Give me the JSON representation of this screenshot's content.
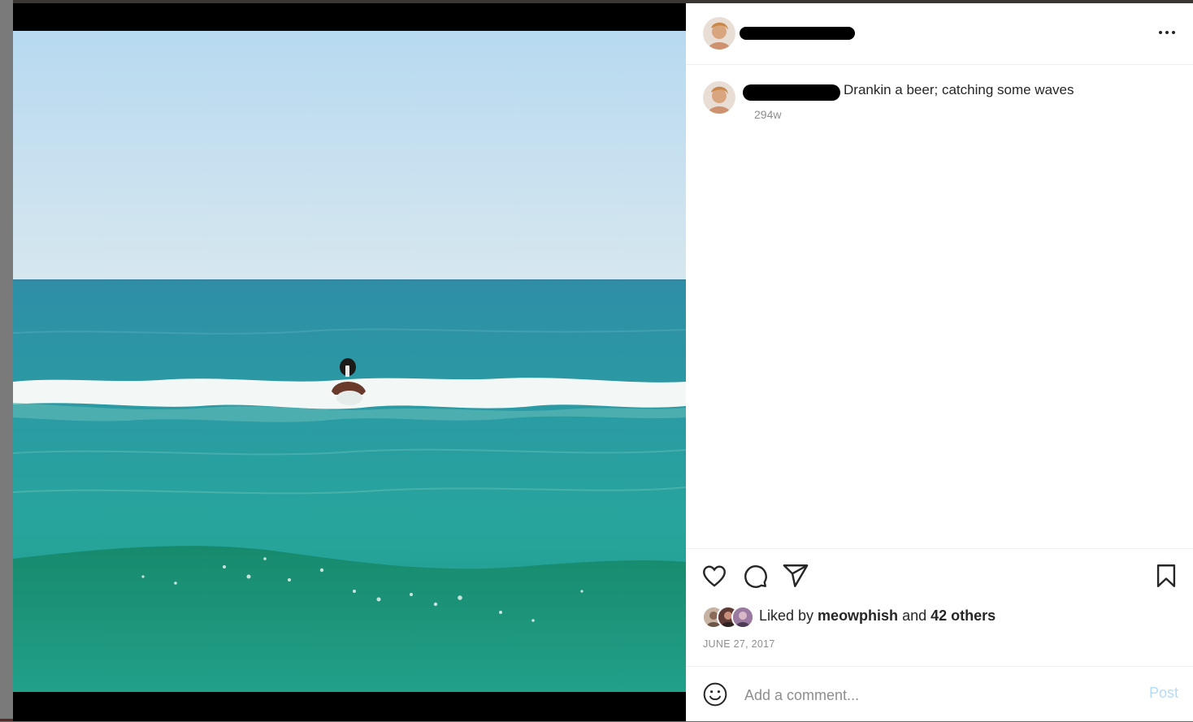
{
  "post": {
    "caption": "Drankin a beer; catching some waves",
    "time_ago": "294w",
    "likes": {
      "prefix": "Liked by ",
      "first_liker": "meowphish",
      "joiner": " and ",
      "others": "42 others"
    },
    "date": "JUNE 27, 2017"
  },
  "comment": {
    "placeholder": "Add a comment...",
    "post_label": "Post"
  },
  "icons": {
    "more": "more-options-icon",
    "like": "heart-icon",
    "comment": "comment-icon",
    "share": "share-icon",
    "save": "bookmark-icon",
    "emoji": "emoji-icon"
  },
  "colors": {
    "text": "#262626",
    "secondary": "#8e8e8e",
    "post_button_disabled": "#b3dbff",
    "divider": "#efefef"
  }
}
